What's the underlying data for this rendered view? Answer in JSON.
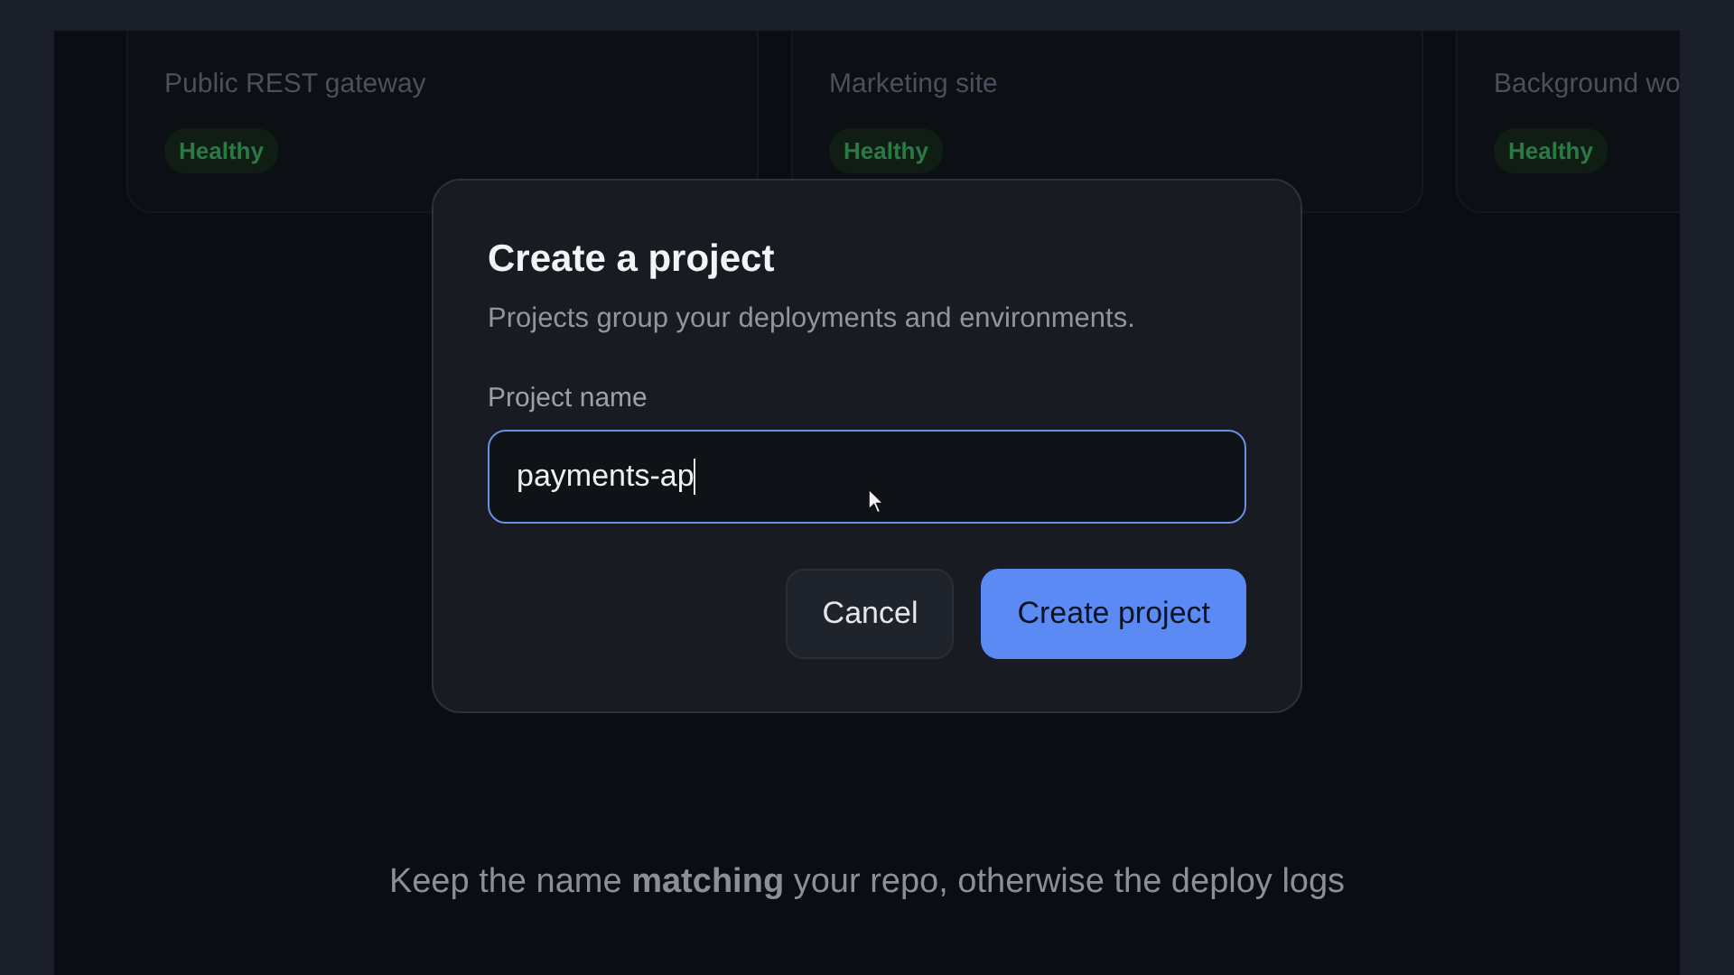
{
  "project_cards": [
    {
      "description": "Public REST gateway",
      "status": "Healthy"
    },
    {
      "description": "Marketing site",
      "status": "Healthy"
    },
    {
      "description": "Background wo",
      "status": "Healthy"
    }
  ],
  "dialog": {
    "title": "Create a project",
    "description": "Projects group your deployments and environments.",
    "field": {
      "label": "Project name",
      "value": "payments-ap",
      "focused": true
    },
    "buttons": [
      {
        "label": "Cancel",
        "kind": "secondary"
      },
      {
        "label": "Create project",
        "kind": "primary"
      }
    ]
  },
  "caption": "Keep the name **matching** your repo, otherwise the deploy logs"
}
